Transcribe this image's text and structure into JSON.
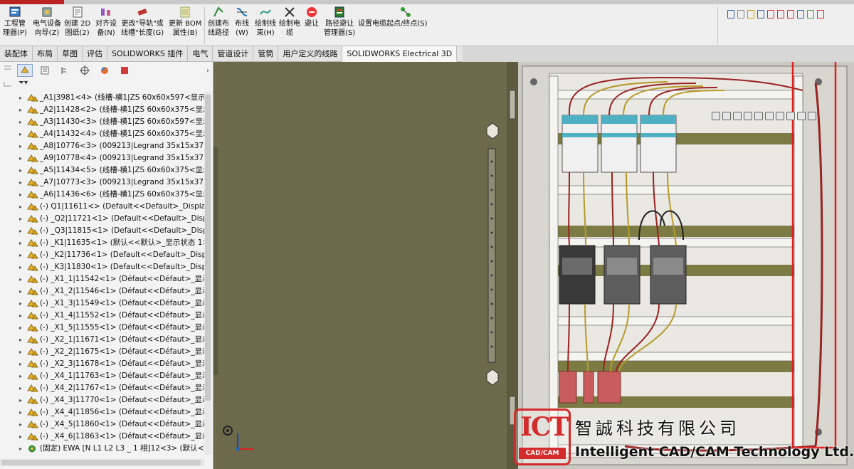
{
  "ribbon": {
    "buttons": [
      {
        "id": "project-manager",
        "label1": "工程管",
        "label2": "理器(P)"
      },
      {
        "id": "electrical-wizard",
        "label1": "电气设备",
        "label2": "向导(Z)"
      },
      {
        "id": "create-2d",
        "label1": "创建 2D",
        "label2": "图纸(2)"
      },
      {
        "id": "align-equipment",
        "label1": "对齐设",
        "label2": "备(N)"
      },
      {
        "id": "change-rail-length",
        "label1": "更改\"导轨\"或",
        "label2": "线槽\"长度(G)"
      },
      {
        "id": "update-bom",
        "label1": "更新 BOM",
        "label2": "属性(B)"
      },
      {
        "id": "create-route",
        "label1": "创建布",
        "label2": "线路径"
      },
      {
        "id": "route-wire",
        "label1": "布线",
        "label2": "(W)"
      },
      {
        "id": "draw-bundle",
        "label1": "绘制线",
        "label2": "束(H)"
      },
      {
        "id": "draw-cable",
        "label1": "绘制电",
        "label2": "缆"
      },
      {
        "id": "avoid",
        "label1": "避让",
        "label2": ""
      },
      {
        "id": "route-avoid-manager",
        "label1": "路径避让",
        "label2": "管理器(S)"
      }
    ],
    "cable_endpoint": "设置电缆起点/终点(S)"
  },
  "tabs": [
    "装配体",
    "布局",
    "草图",
    "评估",
    "SOLIDWORKS 插件",
    "电气",
    "管道设计",
    "管筒",
    "用户定义的线路",
    "SOLIDWORKS Electrical 3D"
  ],
  "active_tab": 9,
  "tree": {
    "items": [
      {
        "icon": "assembly-icon",
        "text": "_A1|3981<4> (线槽-横1|ZS 60x60x597<显示状态"
      },
      {
        "icon": "assembly-icon",
        "text": "_A2|11428<2> (线槽-横1|ZS 60x60x375<显示状"
      },
      {
        "icon": "assembly-icon",
        "text": "_A3|11430<3> (线槽-横1|ZS 60x60x597<显示状"
      },
      {
        "icon": "assembly-icon",
        "text": "_A4|11432<4> (线槽-横1|ZS 60x60x375<显示状"
      },
      {
        "icon": "assembly-icon",
        "text": "_A8|10776<3> (009213|Legrand 35x15x375<"
      },
      {
        "icon": "assembly-icon",
        "text": "_A9|10778<4> (009213|Legrand 35x15x375<"
      },
      {
        "icon": "assembly-icon",
        "text": "_A5|11434<5> (线槽-横1|ZS 60x60x375<显示状"
      },
      {
        "icon": "assembly-icon",
        "text": "_A7|10773<3> (009213|Legrand 35x15x375<"
      },
      {
        "icon": "assembly-icon",
        "text": "_A6|11436<6> (线槽-横1|ZS 60x60x375<显示状"
      },
      {
        "icon": "assembly-icon",
        "text": "(-) Q1|11611<> (Default<<Default>_Display S"
      },
      {
        "icon": "assembly-icon",
        "text": "(-) _Q2|11721<1> (Default<<Default>_Displa"
      },
      {
        "icon": "assembly-icon",
        "text": "(-) _Q3|11815<1> (Default<<Default>_Displa"
      },
      {
        "icon": "assembly-icon",
        "text": "(-) _K1|11635<1> (默认<<默认>_显示状态 1>)"
      },
      {
        "icon": "assembly-icon",
        "text": "(-) _K2|11736<1> (Default<<Default>_Displa"
      },
      {
        "icon": "assembly-icon",
        "text": "(-) _K3|11830<1> (Default<<Default>_Displa"
      },
      {
        "icon": "assembly-icon",
        "text": "(-) _X1_1|11542<1> (Défaut<<Défaut>_显示状"
      },
      {
        "icon": "assembly-icon",
        "text": "(-) _X1_2|11546<1> (Défaut<<Défaut>_显示状"
      },
      {
        "icon": "assembly-icon",
        "text": "(-) _X1_3|11549<1> (Défaut<<Défaut>_显示状"
      },
      {
        "icon": "assembly-icon",
        "text": "(-) _X1_4|11552<1> (Défaut<<Défaut>_显示状"
      },
      {
        "icon": "assembly-icon",
        "text": "(-) _X1_5|11555<1> (Défaut<<Défaut>_显示状"
      },
      {
        "icon": "assembly-icon",
        "text": "(-) _X2_1|11671<1> (Défaut<<Défaut>_显示状"
      },
      {
        "icon": "assembly-icon",
        "text": "(-) _X2_2|11675<1> (Défaut<<Défaut>_显示状"
      },
      {
        "icon": "assembly-icon",
        "text": "(-) _X2_3|11678<1> (Défaut<<Défaut>_显示状"
      },
      {
        "icon": "assembly-icon",
        "text": "(-) _X4_1|11763<1> (Défaut<<Défaut>_显示状"
      },
      {
        "icon": "assembly-icon",
        "text": "(-) _X4_2|11767<1> (Défaut<<Défaut>_显示状"
      },
      {
        "icon": "assembly-icon",
        "text": "(-) _X4_3|11770<1> (Défaut<<Défaut>_显示状"
      },
      {
        "icon": "assembly-icon",
        "text": "(-) _X4_4|11856<1> (Défaut<<Défaut>_显示状"
      },
      {
        "icon": "assembly-icon",
        "text": "(-) _X4_5|11860<1> (Défaut<<Défaut>_显示状"
      },
      {
        "icon": "assembly-icon",
        "text": "(-) _X4_6|11863<1> (Défaut<<Défaut>_显示状"
      },
      {
        "icon": "route-assembly-icon",
        "text": "(固定) EWA [N L1 L2 L3 _ 1 相]12<3> (默认<显"
      }
    ]
  },
  "watermark": {
    "logo": "ICT",
    "logo_sub": "CAD/CAM",
    "cn": "智誠科技有限公司",
    "en": "Intelligent CAD/CAM Technology Ltd."
  },
  "colors": {
    "door": "#6d6a4c",
    "highlight": "#e02020",
    "wire_red": "#9a2222",
    "wire_yellow": "#b79a2a",
    "breaker_top": "#4fb0c4"
  }
}
